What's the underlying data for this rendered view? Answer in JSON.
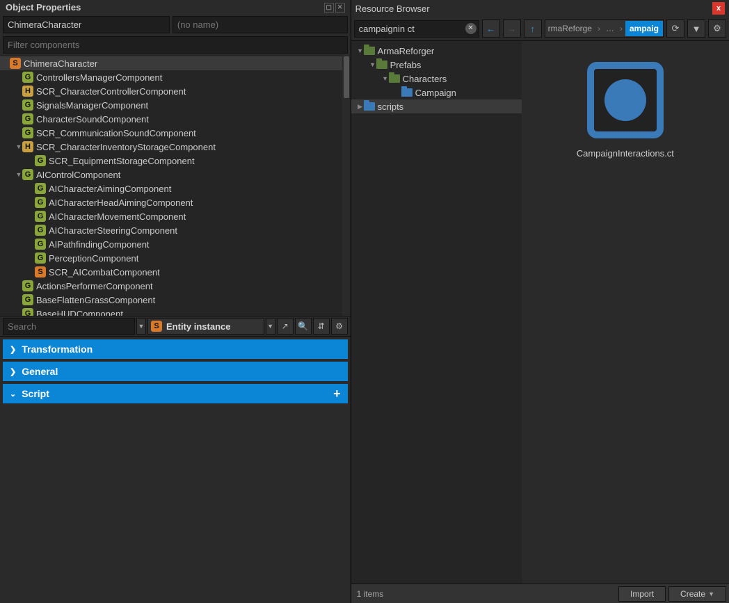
{
  "left": {
    "title": "Object Properties",
    "entity_name": "ChimeraCharacter",
    "noname_placeholder": "(no name)",
    "filter_placeholder": "Filter components",
    "search_placeholder": "Search",
    "entity_chip": "Entity instance",
    "tree": [
      {
        "depth": 0,
        "arrow": "",
        "badge": "S",
        "label": "ChimeraCharacter",
        "selected": true
      },
      {
        "depth": 1,
        "arrow": "",
        "badge": "G",
        "label": "ControllersManagerComponent"
      },
      {
        "depth": 1,
        "arrow": "",
        "badge": "H",
        "label": "SCR_CharacterControllerComponent"
      },
      {
        "depth": 1,
        "arrow": "",
        "badge": "G",
        "label": "SignalsManagerComponent"
      },
      {
        "depth": 1,
        "arrow": "",
        "badge": "G",
        "label": "CharacterSoundComponent"
      },
      {
        "depth": 1,
        "arrow": "",
        "badge": "G",
        "label": "SCR_CommunicationSoundComponent"
      },
      {
        "depth": 1,
        "arrow": "open",
        "badge": "H",
        "label": "SCR_CharacterInventoryStorageComponent"
      },
      {
        "depth": 2,
        "arrow": "",
        "badge": "G",
        "label": "SCR_EquipmentStorageComponent"
      },
      {
        "depth": 1,
        "arrow": "open",
        "badge": "G",
        "label": "AIControlComponent"
      },
      {
        "depth": 2,
        "arrow": "",
        "badge": "G",
        "label": "AICharacterAimingComponent"
      },
      {
        "depth": 2,
        "arrow": "",
        "badge": "G",
        "label": "AICharacterHeadAimingComponent"
      },
      {
        "depth": 2,
        "arrow": "",
        "badge": "G",
        "label": "AICharacterMovementComponent"
      },
      {
        "depth": 2,
        "arrow": "",
        "badge": "G",
        "label": "AICharacterSteeringComponent"
      },
      {
        "depth": 2,
        "arrow": "",
        "badge": "G",
        "label": "AIPathfindingComponent"
      },
      {
        "depth": 2,
        "arrow": "",
        "badge": "G",
        "label": "PerceptionComponent"
      },
      {
        "depth": 2,
        "arrow": "",
        "badge": "S",
        "label": "SCR_AICombatComponent"
      },
      {
        "depth": 1,
        "arrow": "",
        "badge": "G",
        "label": "ActionsPerformerComponent"
      },
      {
        "depth": 1,
        "arrow": "",
        "badge": "G",
        "label": "BaseFlattenGrassComponent"
      },
      {
        "depth": 1,
        "arrow": "",
        "badge": "G",
        "label": "BaseHUDComponent"
      }
    ],
    "sections": {
      "transformation": "Transformation",
      "general": "General",
      "script": "Script"
    }
  },
  "right": {
    "title": "Resource Browser",
    "search_value": "campaignin ct",
    "breadcrumb": {
      "part1": "rmaReforge",
      "ell": "…",
      "active": "ampaig"
    },
    "tree": [
      {
        "depth": 0,
        "arrow": "open",
        "folder": "open-f",
        "label": "ArmaReforger"
      },
      {
        "depth": 1,
        "arrow": "open",
        "folder": "open-f",
        "label": "Prefabs"
      },
      {
        "depth": 2,
        "arrow": "open",
        "folder": "open-f",
        "label": "Characters"
      },
      {
        "depth": 3,
        "arrow": "",
        "folder": "closed-f",
        "label": "Campaign"
      },
      {
        "depth": 0,
        "arrow": "closed",
        "folder": "closed-f",
        "label": "scripts",
        "selected": true
      }
    ],
    "file_name": "CampaignInteractions.ct",
    "status": "1 items",
    "import": "Import",
    "create": "Create"
  }
}
